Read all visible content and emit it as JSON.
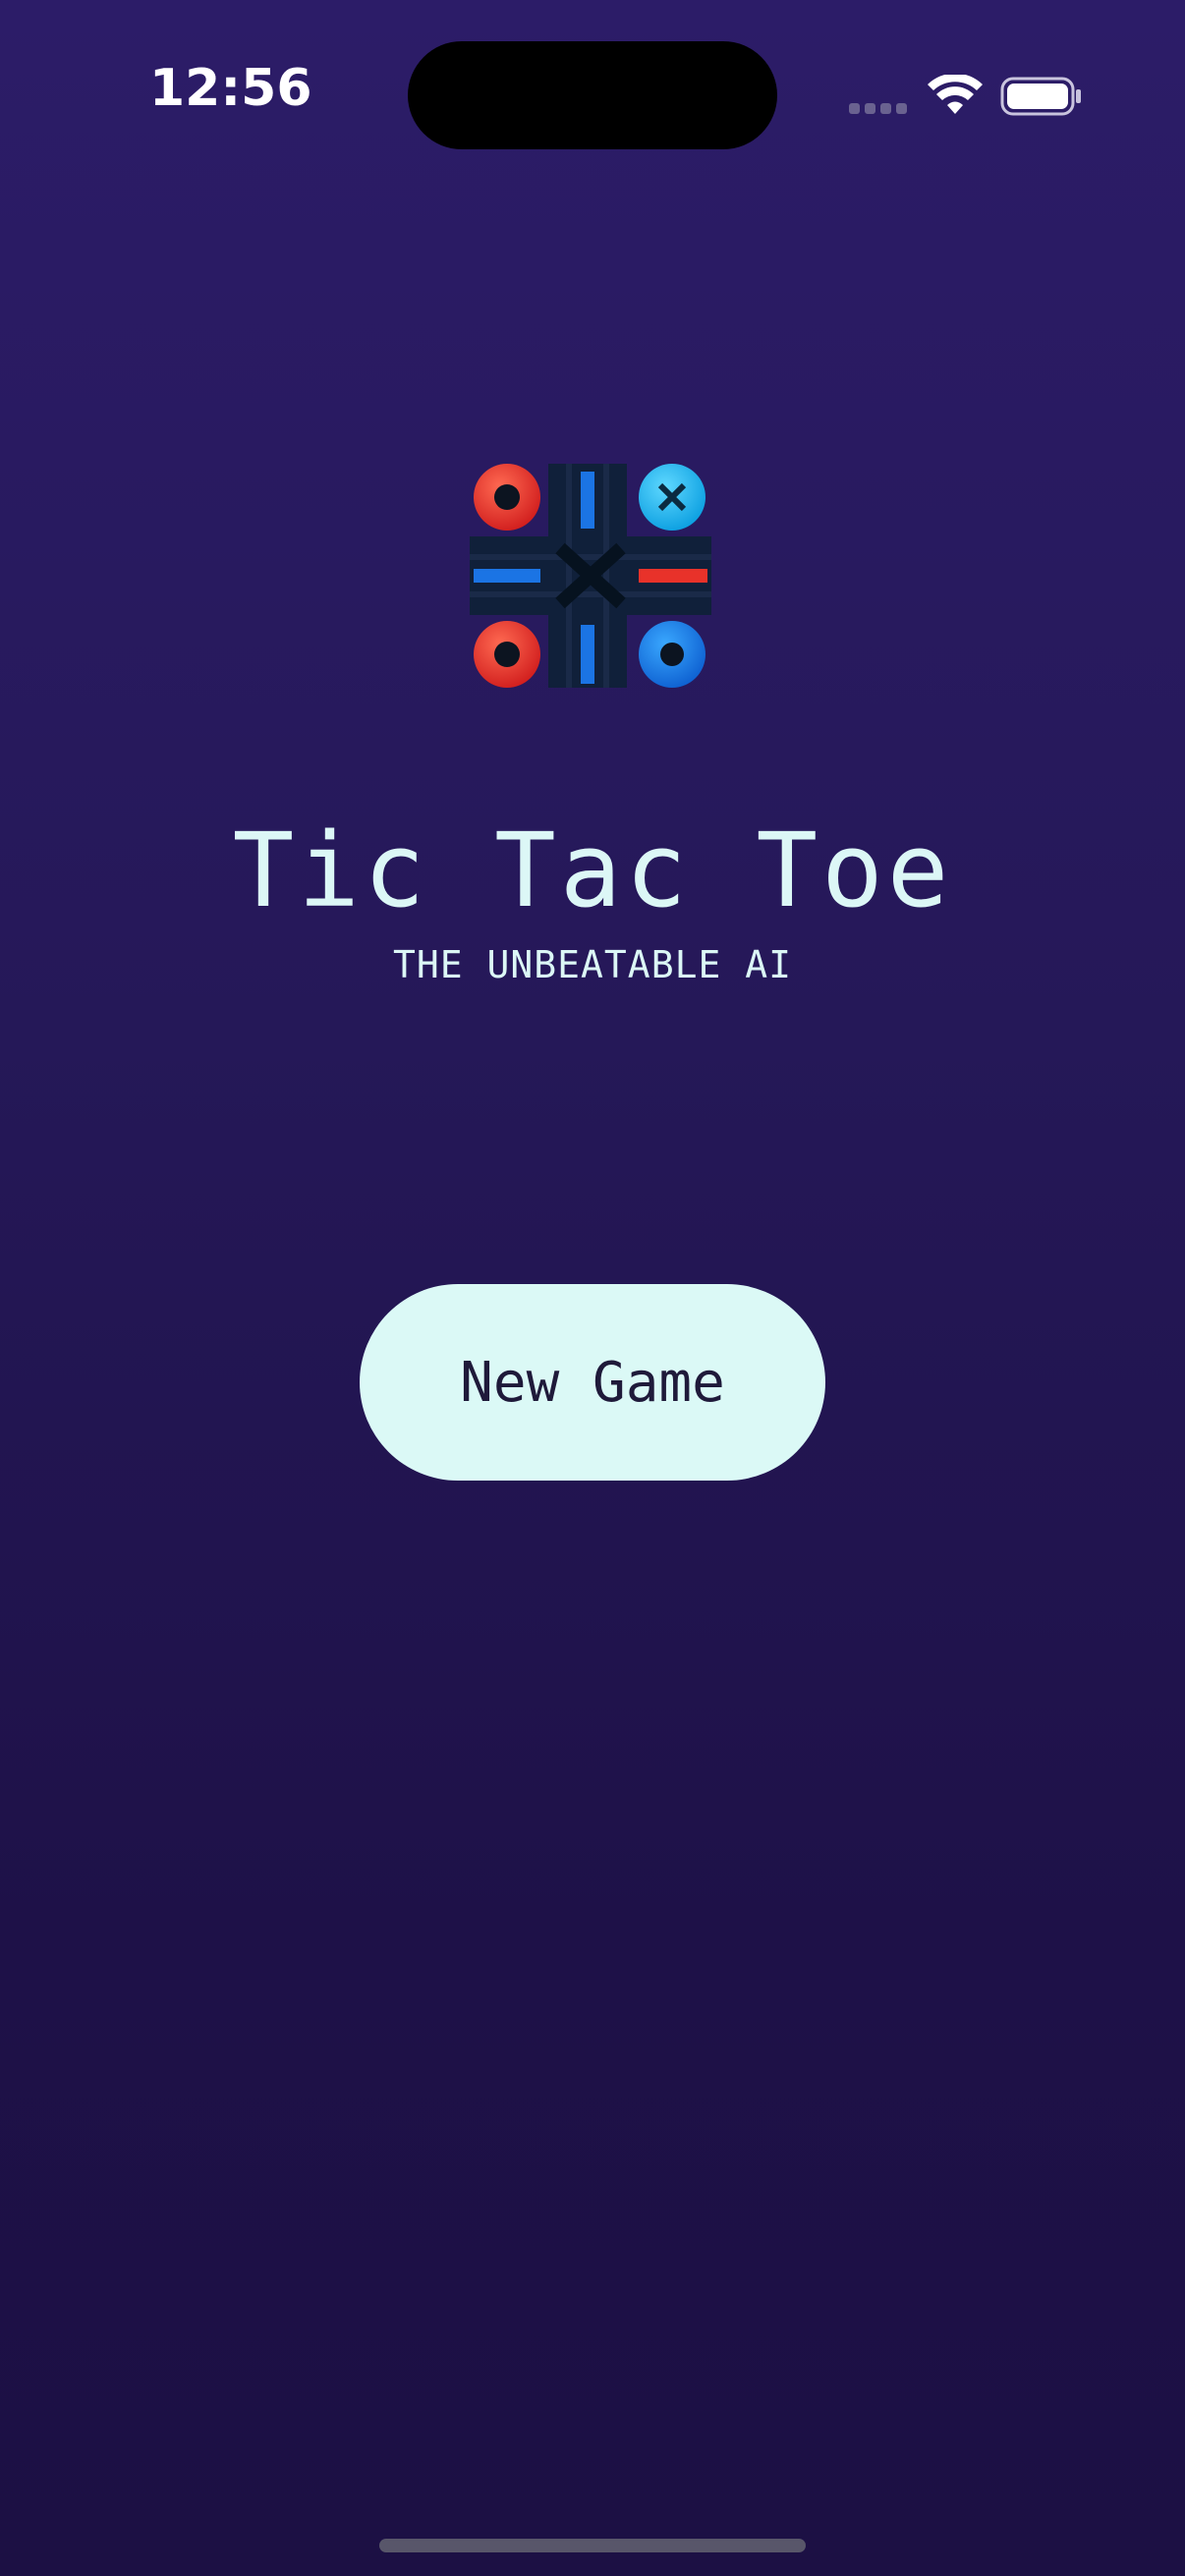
{
  "status_bar": {
    "time": "12:56"
  },
  "logo": {
    "icon": "tic-tac-toe-logo-icon",
    "red": "#e8322a",
    "blue": "#1b74e4"
  },
  "title": "Tic Tac Toe",
  "subtitle": "THE UNBEATABLE AI",
  "new_game_button": {
    "label": "New Game"
  },
  "colors": {
    "background": "#261a5c",
    "button": "#dbf9f6",
    "title_text": "#dcf7f6"
  }
}
